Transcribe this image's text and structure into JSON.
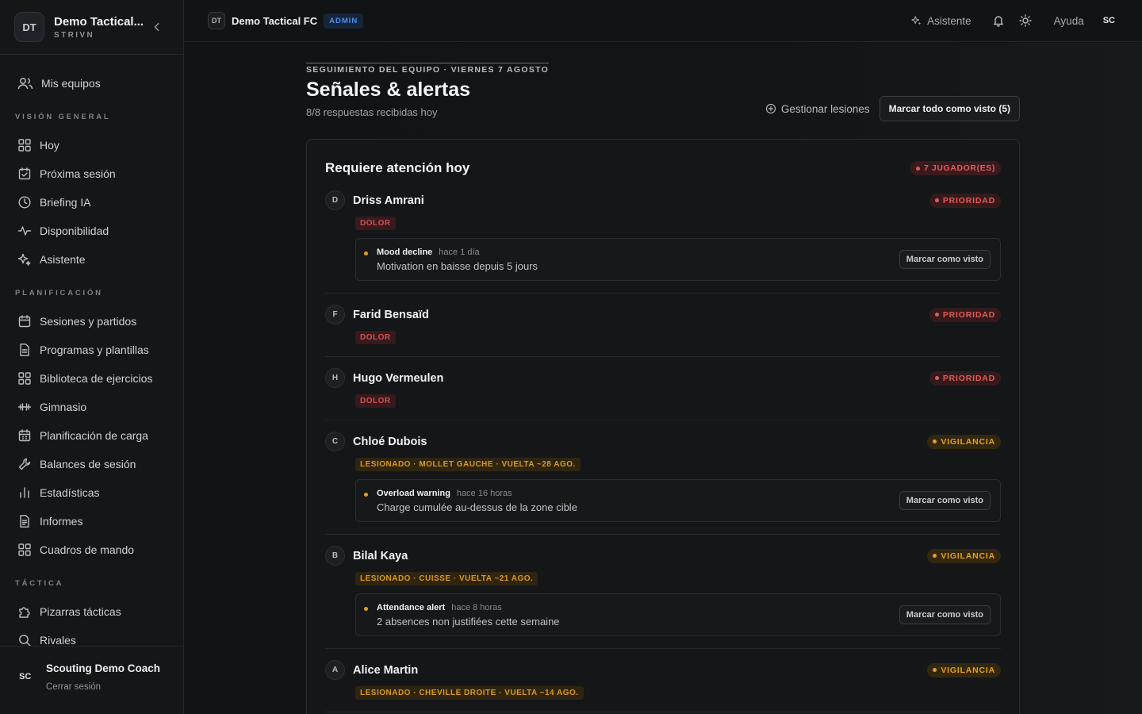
{
  "sidebar": {
    "logo": "DT",
    "title": "Demo Tactical...",
    "subtitle": "STRIVN",
    "top_item": {
      "label": "Mis equipos",
      "icon": "users-icon"
    },
    "sections": [
      {
        "title": "VISIÓN GENERAL",
        "items": [
          {
            "label": "Hoy",
            "icon": "grid-icon"
          },
          {
            "label": "Próxima sesión",
            "icon": "calendar-check-icon"
          },
          {
            "label": "Briefing IA",
            "icon": "clock-icon"
          },
          {
            "label": "Disponibilidad",
            "icon": "activity-icon"
          },
          {
            "label": "Asistente",
            "icon": "sparkles-icon"
          }
        ]
      },
      {
        "title": "PLANIFICACIÓN",
        "items": [
          {
            "label": "Sesiones y partidos",
            "icon": "calendar-icon"
          },
          {
            "label": "Programas y plantillas",
            "icon": "file-icon"
          },
          {
            "label": "Biblioteca de ejercicios",
            "icon": "grid-icon"
          },
          {
            "label": "Gimnasio",
            "icon": "dumbbell-icon"
          },
          {
            "label": "Planificación de carga",
            "icon": "calendar-grid-icon"
          },
          {
            "label": "Balances de sesión",
            "icon": "wrench-icon"
          },
          {
            "label": "Estadísticas",
            "icon": "bar-chart-icon"
          },
          {
            "label": "Informes",
            "icon": "file-text-icon"
          },
          {
            "label": "Cuadros de mando",
            "icon": "grid-icon"
          }
        ]
      },
      {
        "title": "TÁCTICA",
        "items": [
          {
            "label": "Pizarras tácticas",
            "icon": "puzzle-icon"
          },
          {
            "label": "Rivales",
            "icon": "search-icon"
          }
        ]
      }
    ],
    "footer": {
      "avatar": "SC",
      "name": "Scouting Demo Coach",
      "logout": "Cerrar sesión"
    }
  },
  "topbar": {
    "logo": "DT",
    "team": "Demo Tactical FC",
    "badge": "ADMIN",
    "assistant": "Asistente",
    "help": "Ayuda",
    "avatar": "SC"
  },
  "page": {
    "eyebrow": "SEGUIMIENTO DEL EQUIPO · VIERNES 7 AGOSTO",
    "title": "Señales & alertas",
    "subtitle": "8/8 respuestas recibidas hoy",
    "manage_injuries": "Gestionar lesiones",
    "mark_all": "Marcar todo como visto (5)"
  },
  "card": {
    "title": "Requiere atención hoy",
    "count": "7 JUGADOR(ES)",
    "mark_seen_label": "Marcar como visto",
    "players": [
      {
        "initial": "D",
        "name": "Driss Amrani",
        "status": "PRIORIDAD",
        "level": "red",
        "tag": "DOLOR",
        "alert": {
          "title": "Mood decline",
          "time": "hace 1 día",
          "text": "Motivation en baisse depuis 5 jours"
        }
      },
      {
        "initial": "F",
        "name": "Farid Bensaïd",
        "status": "PRIORIDAD",
        "level": "red",
        "tag": "DOLOR"
      },
      {
        "initial": "H",
        "name": "Hugo Vermeulen",
        "status": "PRIORIDAD",
        "level": "red",
        "tag": "DOLOR"
      },
      {
        "initial": "C",
        "name": "Chloé Dubois",
        "status": "VIGILANCIA",
        "level": "amber",
        "tag": "LESIONADO · MOLLET GAUCHE · VUELTA ~28 AGO.",
        "alert": {
          "title": "Overload warning",
          "time": "hace 16 horas",
          "text": "Charge cumulée au-dessus de la zone cible"
        }
      },
      {
        "initial": "B",
        "name": "Bilal Kaya",
        "status": "VIGILANCIA",
        "level": "amber",
        "tag": "LESIONADO · CUISSE · VUELTA ~21 AGO.",
        "alert": {
          "title": "Attendance alert",
          "time": "hace 8 horas",
          "text": "2 absences non justifiées cette semaine"
        }
      },
      {
        "initial": "A",
        "name": "Alice Martin",
        "status": "VIGILANCIA",
        "level": "amber",
        "tag": "LESIONADO · CHEVILLE DROITE · VUELTA ~14 AGO."
      }
    ]
  }
}
